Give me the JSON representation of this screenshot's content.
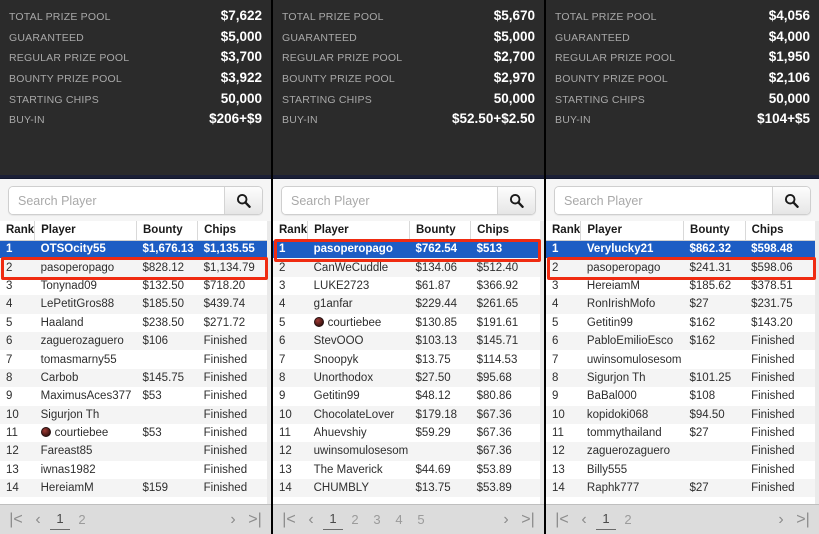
{
  "search": {
    "placeholder": "Search Player",
    "value": "",
    "icon": "search-icon"
  },
  "columns": {
    "rank": "Rank",
    "player": "Player",
    "bounty": "Bounty",
    "chips": "Chips"
  },
  "info_labels": {
    "total_prize_pool": "TOTAL PRIZE POOL",
    "guaranteed": "GUARANTEED",
    "regular_prize_pool": "REGULAR PRIZE POOL",
    "bounty_prize_pool": "BOUNTY PRIZE POOL",
    "starting_chips": "STARTING CHIPS",
    "buy_in": "BUY-IN"
  },
  "pager_icons": {
    "first": "|<",
    "prev": "‹",
    "next": "›",
    "last": ">|"
  },
  "colors": {
    "highlight_row": "#1d5dc4",
    "red_box": "#ef2b11",
    "info_bg": "#2b2b2b",
    "info_label": "#a8a8a8",
    "info_value": "#ffffff"
  },
  "panels": [
    {
      "id": "panel-1",
      "info": {
        "total_prize_pool": "$7,622",
        "guaranteed": "$5,000",
        "regular_prize_pool": "$3,700",
        "bounty_prize_pool": "$3,922",
        "starting_chips": "50,000",
        "buy_in": "$206+$9"
      },
      "pages": [
        "1",
        "2"
      ],
      "current_page": "1",
      "highlight_rank": "1",
      "redbox_rank": "2",
      "rows": [
        {
          "rank": "1",
          "player": "OTSOcity55",
          "bounty": "$1,676.13",
          "chips": "$1,135.55",
          "avatar": false,
          "selected": true
        },
        {
          "rank": "2",
          "player": "pasoperopago",
          "bounty": "$828.12",
          "chips": "$1,134.79",
          "avatar": false,
          "selected": false
        },
        {
          "rank": "3",
          "player": "Tonynad09",
          "bounty": "$132.50",
          "chips": "$718.20",
          "avatar": false,
          "selected": false
        },
        {
          "rank": "4",
          "player": "LePetitGros88",
          "bounty": "$185.50",
          "chips": "$439.74",
          "avatar": false,
          "selected": false
        },
        {
          "rank": "5",
          "player": "Haaland",
          "bounty": "$238.50",
          "chips": "$271.72",
          "avatar": false,
          "selected": false
        },
        {
          "rank": "6",
          "player": "zaguerozaguero",
          "bounty": "$106",
          "chips": "Finished",
          "avatar": false,
          "selected": false
        },
        {
          "rank": "7",
          "player": "tomasmarny55",
          "bounty": "",
          "chips": "Finished",
          "avatar": false,
          "selected": false
        },
        {
          "rank": "8",
          "player": "Carbob",
          "bounty": "$145.75",
          "chips": "Finished",
          "avatar": false,
          "selected": false
        },
        {
          "rank": "9",
          "player": "MaximusAces377",
          "bounty": "$53",
          "chips": "Finished",
          "avatar": false,
          "selected": false
        },
        {
          "rank": "10",
          "player": "Sigurjon Th",
          "bounty": "",
          "chips": "Finished",
          "avatar": false,
          "selected": false
        },
        {
          "rank": "11",
          "player": "courtiebee",
          "bounty": "$53",
          "chips": "Finished",
          "avatar": true,
          "selected": false
        },
        {
          "rank": "12",
          "player": "Fareast85",
          "bounty": "",
          "chips": "Finished",
          "avatar": false,
          "selected": false
        },
        {
          "rank": "13",
          "player": "iwnas1982",
          "bounty": "",
          "chips": "Finished",
          "avatar": false,
          "selected": false
        },
        {
          "rank": "14",
          "player": "HereiamM",
          "bounty": "$159",
          "chips": "Finished",
          "avatar": false,
          "selected": false
        }
      ]
    },
    {
      "id": "panel-2",
      "info": {
        "total_prize_pool": "$5,670",
        "guaranteed": "$5,000",
        "regular_prize_pool": "$2,700",
        "bounty_prize_pool": "$2,970",
        "starting_chips": "50,000",
        "buy_in": "$52.50+$2.50"
      },
      "pages": [
        "1",
        "2",
        "3",
        "4",
        "5"
      ],
      "current_page": "1",
      "highlight_rank": "1",
      "redbox_rank": "1",
      "rows": [
        {
          "rank": "1",
          "player": "pasoperopago",
          "bounty": "$762.54",
          "chips": "$513",
          "avatar": false,
          "selected": true
        },
        {
          "rank": "2",
          "player": "CanWeCuddle",
          "bounty": "$134.06",
          "chips": "$512.40",
          "avatar": false,
          "selected": false
        },
        {
          "rank": "3",
          "player": "LUKE2723",
          "bounty": "$61.87",
          "chips": "$366.92",
          "avatar": false,
          "selected": false
        },
        {
          "rank": "4",
          "player": "g1anfar",
          "bounty": "$229.44",
          "chips": "$261.65",
          "avatar": false,
          "selected": false
        },
        {
          "rank": "5",
          "player": "courtiebee",
          "bounty": "$130.85",
          "chips": "$191.61",
          "avatar": true,
          "selected": false
        },
        {
          "rank": "6",
          "player": "StevOOO",
          "bounty": "$103.13",
          "chips": "$145.71",
          "avatar": false,
          "selected": false
        },
        {
          "rank": "7",
          "player": "Snoopyk",
          "bounty": "$13.75",
          "chips": "$114.53",
          "avatar": false,
          "selected": false
        },
        {
          "rank": "8",
          "player": "Unorthodox",
          "bounty": "$27.50",
          "chips": "$95.68",
          "avatar": false,
          "selected": false
        },
        {
          "rank": "9",
          "player": "Getitin99",
          "bounty": "$48.12",
          "chips": "$80.86",
          "avatar": false,
          "selected": false
        },
        {
          "rank": "10",
          "player": "ChocolateLover",
          "bounty": "$179.18",
          "chips": "$67.36",
          "avatar": false,
          "selected": false
        },
        {
          "rank": "11",
          "player": "Ahuevshiy",
          "bounty": "$59.29",
          "chips": "$67.36",
          "avatar": false,
          "selected": false
        },
        {
          "rank": "12",
          "player": "uwinsomulosesom",
          "bounty": "",
          "chips": "$67.36",
          "avatar": false,
          "selected": false
        },
        {
          "rank": "13",
          "player": "The Maverick",
          "bounty": "$44.69",
          "chips": "$53.89",
          "avatar": false,
          "selected": false
        },
        {
          "rank": "14",
          "player": "CHUMBLY",
          "bounty": "$13.75",
          "chips": "$53.89",
          "avatar": false,
          "selected": false
        }
      ]
    },
    {
      "id": "panel-3",
      "info": {
        "total_prize_pool": "$4,056",
        "guaranteed": "$4,000",
        "regular_prize_pool": "$1,950",
        "bounty_prize_pool": "$2,106",
        "starting_chips": "50,000",
        "buy_in": "$104+$5"
      },
      "pages": [
        "1",
        "2"
      ],
      "current_page": "1",
      "highlight_rank": "1",
      "redbox_rank": "2",
      "rows": [
        {
          "rank": "1",
          "player": "Verylucky21",
          "bounty": "$862.32",
          "chips": "$598.48",
          "avatar": false,
          "selected": true
        },
        {
          "rank": "2",
          "player": "pasoperopago",
          "bounty": "$241.31",
          "chips": "$598.06",
          "avatar": false,
          "selected": false
        },
        {
          "rank": "3",
          "player": "HereiamM",
          "bounty": "$185.62",
          "chips": "$378.51",
          "avatar": false,
          "selected": false
        },
        {
          "rank": "4",
          "player": "RonIrishMofo",
          "bounty": "$27",
          "chips": "$231.75",
          "avatar": false,
          "selected": false
        },
        {
          "rank": "5",
          "player": "Getitin99",
          "bounty": "$162",
          "chips": "$143.20",
          "avatar": false,
          "selected": false
        },
        {
          "rank": "6",
          "player": "PabloEmilioEsco",
          "bounty": "$162",
          "chips": "Finished",
          "avatar": false,
          "selected": false
        },
        {
          "rank": "7",
          "player": "uwinsomulosesom",
          "bounty": "",
          "chips": "Finished",
          "avatar": false,
          "selected": false
        },
        {
          "rank": "8",
          "player": "Sigurjon Th",
          "bounty": "$101.25",
          "chips": "Finished",
          "avatar": false,
          "selected": false
        },
        {
          "rank": "9",
          "player": "BaBal000",
          "bounty": "$108",
          "chips": "Finished",
          "avatar": false,
          "selected": false
        },
        {
          "rank": "10",
          "player": "kopidoki068",
          "bounty": "$94.50",
          "chips": "Finished",
          "avatar": false,
          "selected": false
        },
        {
          "rank": "11",
          "player": "tommythailand",
          "bounty": "$27",
          "chips": "Finished",
          "avatar": false,
          "selected": false
        },
        {
          "rank": "12",
          "player": "zaguerozaguero",
          "bounty": "",
          "chips": "Finished",
          "avatar": false,
          "selected": false
        },
        {
          "rank": "13",
          "player": "Billy555",
          "bounty": "",
          "chips": "Finished",
          "avatar": false,
          "selected": false
        },
        {
          "rank": "14",
          "player": "Raphk777",
          "bounty": "$27",
          "chips": "Finished",
          "avatar": false,
          "selected": false
        }
      ]
    }
  ]
}
